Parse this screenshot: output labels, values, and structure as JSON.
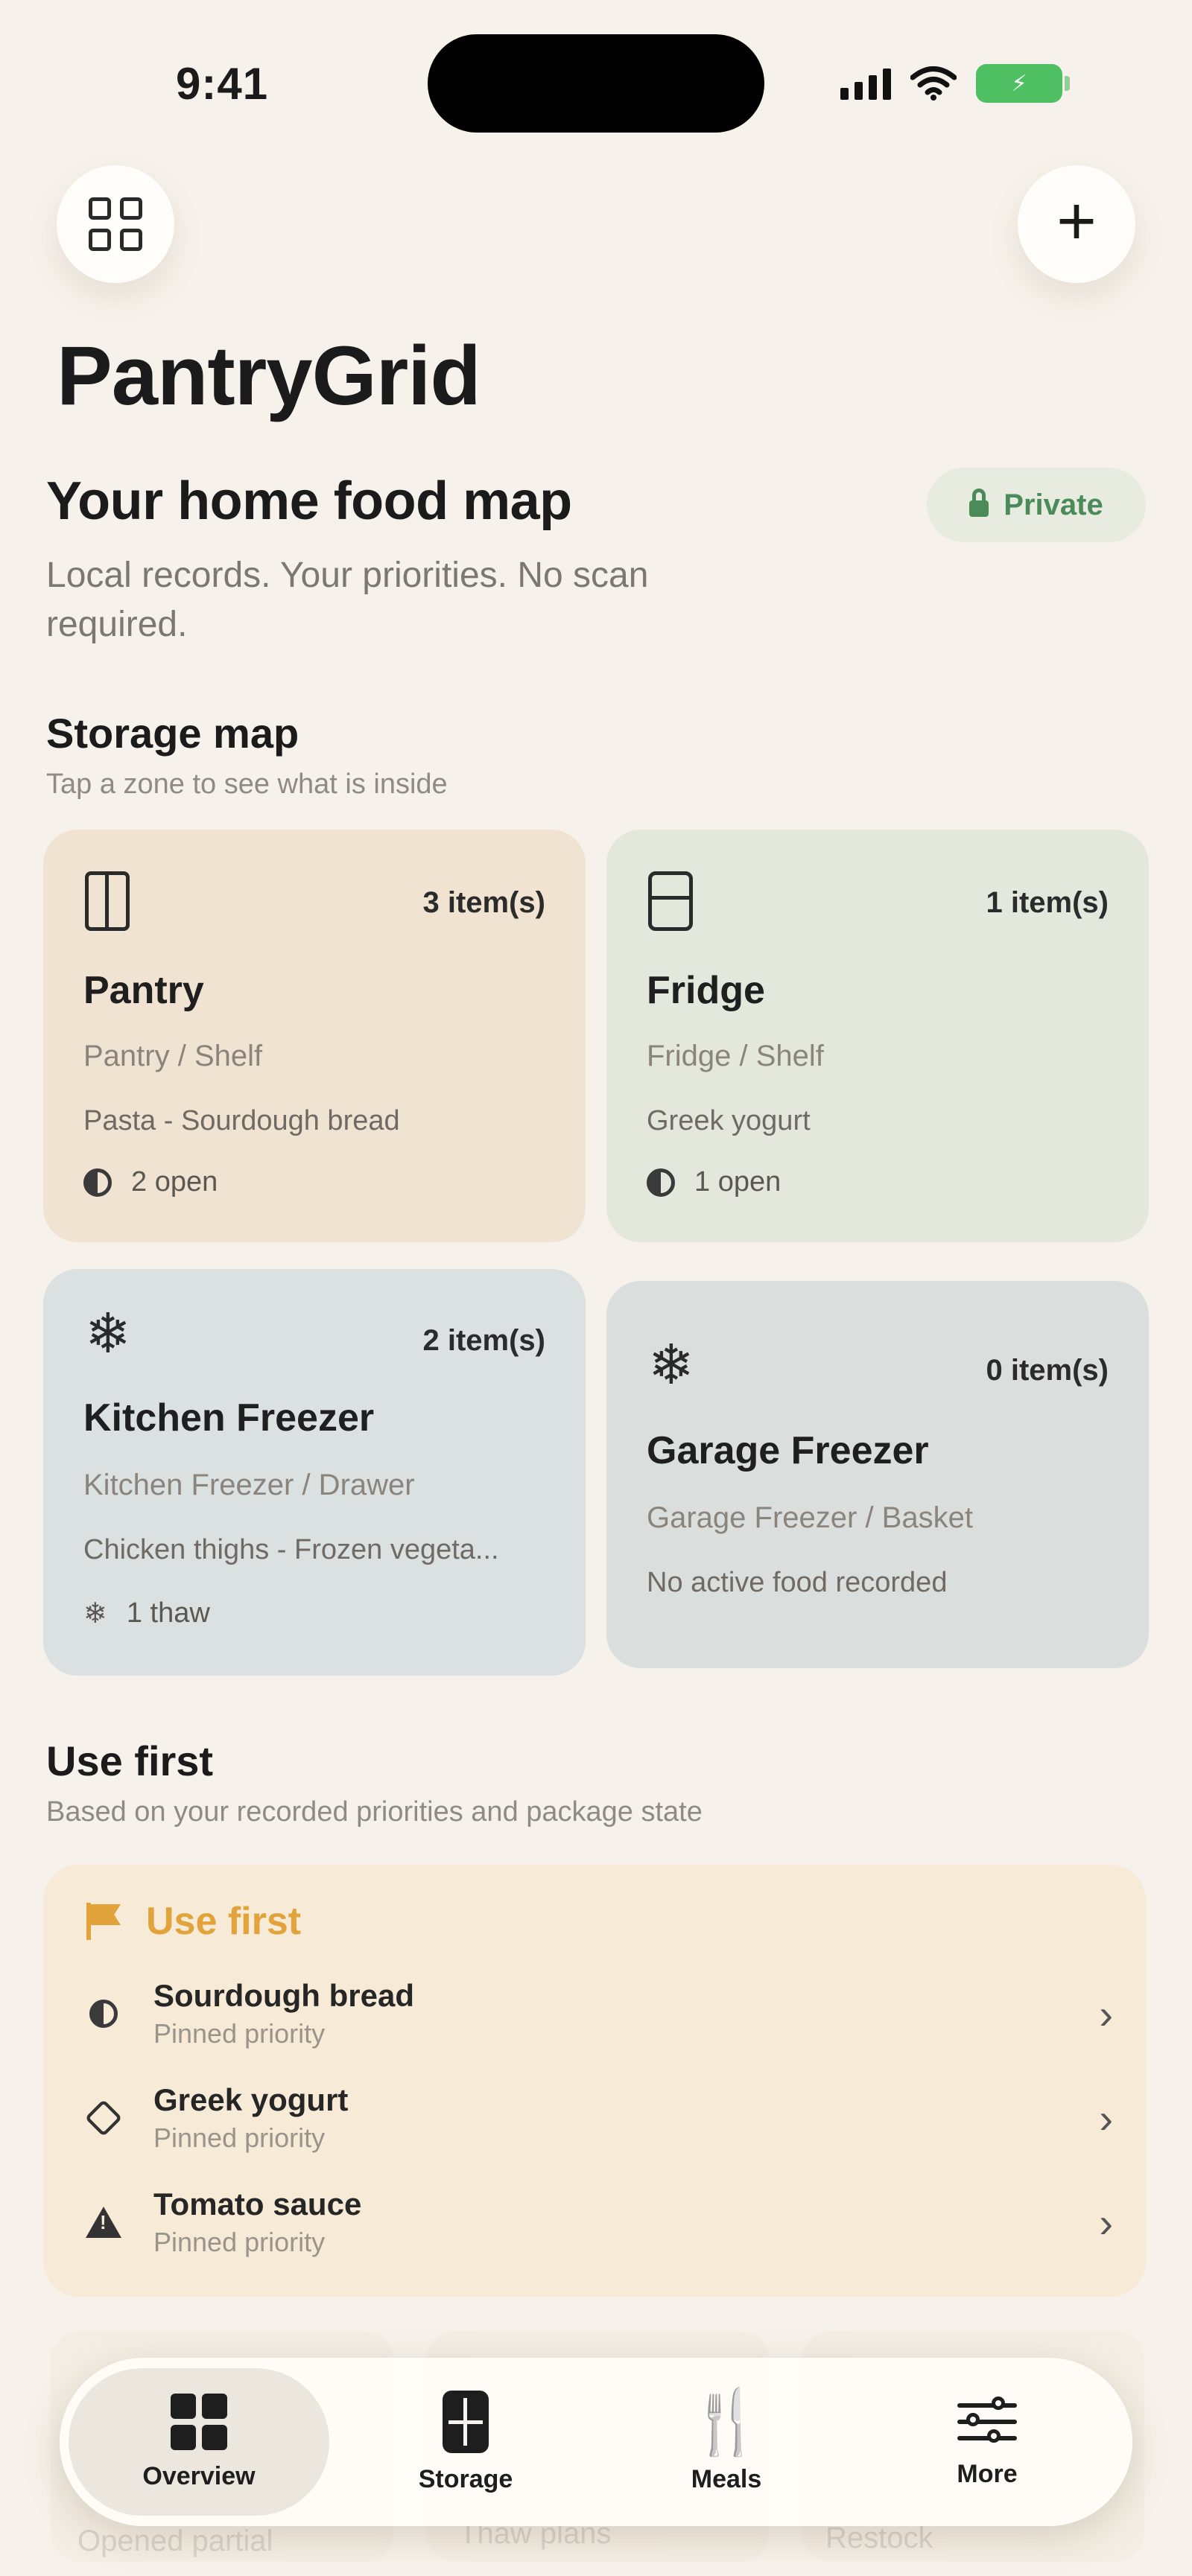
{
  "status_bar": {
    "time": "9:41",
    "battery": "⚡"
  },
  "header": {
    "app_title": "PantryGrid"
  },
  "hero": {
    "title": "Your home food map",
    "subtitle": "Local records. Your priorities. No scan required.",
    "badge": "Private"
  },
  "storage_map": {
    "title": "Storage map",
    "subtitle": "Tap a zone to see what is inside",
    "zones": [
      {
        "name": "Pantry",
        "count": "3 item(s)",
        "location": "Pantry / Shelf",
        "items": "Pasta - Sourdough bread",
        "state": "2 open",
        "icon": "pantry-icon",
        "color": "#f1e3d2"
      },
      {
        "name": "Fridge",
        "count": "1 item(s)",
        "location": "Fridge / Shelf",
        "items": "Greek yogurt",
        "state": "1 open",
        "icon": "fridge-icon",
        "color": "#e4e7dc"
      },
      {
        "name": "Kitchen Freezer",
        "count": "2 item(s)",
        "location": "Kitchen Freezer / Drawer",
        "items": "Chicken thighs - Frozen vegeta...",
        "state": "1 thaw",
        "icon": "snowflake-icon",
        "color": "#dbe0e0"
      },
      {
        "name": "Garage Freezer",
        "count": "0 item(s)",
        "location": "Garage Freezer / Basket",
        "items": "No active food recorded",
        "icon": "snowflake-icon",
        "color": "#dadfde"
      }
    ]
  },
  "use_first": {
    "title": "Use first",
    "subtitle": "Based on your recorded priorities and package state",
    "panel_title": "Use first",
    "accent": "#e2a33a",
    "items": [
      {
        "name": "Sourdough bread",
        "note": "Pinned priority",
        "icon": "half-circle-icon"
      },
      {
        "name": "Greek yogurt",
        "note": "Pinned priority",
        "icon": "package-icon"
      },
      {
        "name": "Tomato sauce",
        "note": "Pinned priority",
        "icon": "warning-icon"
      }
    ]
  },
  "ghost": {
    "labels": [
      "Opened partial",
      "Thaw plans",
      "Restock"
    ]
  },
  "tabbar": {
    "tabs": [
      {
        "label": "Overview",
        "active": true
      },
      {
        "label": "Storage"
      },
      {
        "label": "Meals"
      },
      {
        "label": "More"
      }
    ]
  }
}
